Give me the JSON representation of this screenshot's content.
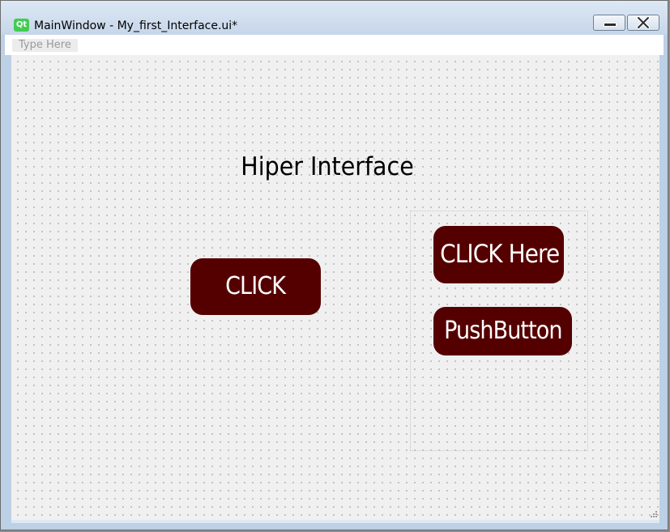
{
  "window": {
    "title": "MainWindow - My_first_Interface.ui*",
    "icon_label": "Qt",
    "icon": "qt-logo-icon"
  },
  "controls": {
    "minimize_icon": "minimize-icon",
    "close_icon": "close-icon"
  },
  "menubar": {
    "placeholder": "Type Here"
  },
  "form": {
    "heading": "Hiper Interface",
    "buttons": {
      "click": "CLICK",
      "click_here": "CLICK Here",
      "push_button": "PushButton"
    }
  },
  "colors": {
    "button_background": "#550000",
    "button_text": "#ffffff",
    "canvas_background": "#f0f0f0",
    "qt_green": "#41cd52"
  }
}
